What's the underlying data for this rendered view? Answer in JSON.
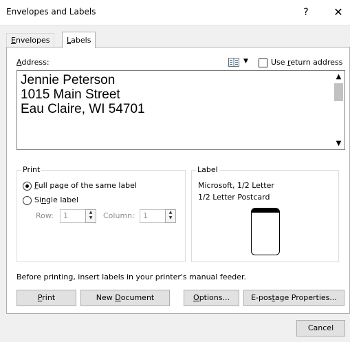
{
  "window": {
    "title": "Envelopes and Labels",
    "help_glyph": "?",
    "close_glyph": "✕"
  },
  "tabs": [
    {
      "label": "Envelopes",
      "accel": "E",
      "rest": "nvelopes",
      "active": false
    },
    {
      "label": "Labels",
      "accel": "L",
      "rest": "abels",
      "active": true
    }
  ],
  "address": {
    "label": "Address:",
    "accel": "A",
    "rest": "ddress:",
    "lines": [
      "Jennie Peterson",
      "1015 Main Street",
      "Eau Claire, WI 54701"
    ],
    "text": "Jennie Peterson\n1015 Main Street\nEau Claire, WI 54701",
    "address_book_icon": "address-book-icon",
    "dropdown_glyph": "▼",
    "use_return_address": {
      "pre": "Use ",
      "accel": "r",
      "rest": "eturn address",
      "label": "Use return address",
      "checked": false
    }
  },
  "print_group": {
    "title": "Print",
    "full_page": {
      "accel": "F",
      "rest": "ull page of the same label",
      "label": "Full page of the same label",
      "selected": true
    },
    "single_label": {
      "pre": "Si",
      "accel": "n",
      "rest": "gle label",
      "label": "Single label",
      "selected": false
    },
    "row_label": "Row:",
    "row_value": "1",
    "column_label": "Column:",
    "column_value": "1"
  },
  "label_group": {
    "title": "Label",
    "vendor": "Microsoft, 1/2 Letter",
    "product": "1/2 Letter Postcard"
  },
  "note": "Before printing, insert labels in your printer's manual feeder.",
  "buttons": {
    "print": {
      "label": "Print",
      "accel": "P",
      "rest": "rint"
    },
    "new_document": {
      "label": "New Document",
      "pre": "New ",
      "accel": "D",
      "rest": "ocument"
    },
    "options": {
      "label": "Options...",
      "accel": "O",
      "rest": "ptions..."
    },
    "epostage": {
      "label": "E-postage Properties...",
      "pre": "E-pos",
      "accel": "t",
      "rest": "age Properties..."
    },
    "cancel": {
      "label": "Cancel"
    }
  },
  "colors": {
    "dialog_bg": "#f0f0f0",
    "panel_bg": "#ffffff",
    "button_bg": "#e1e1e1",
    "disabled_text": "#8c8c8c"
  }
}
